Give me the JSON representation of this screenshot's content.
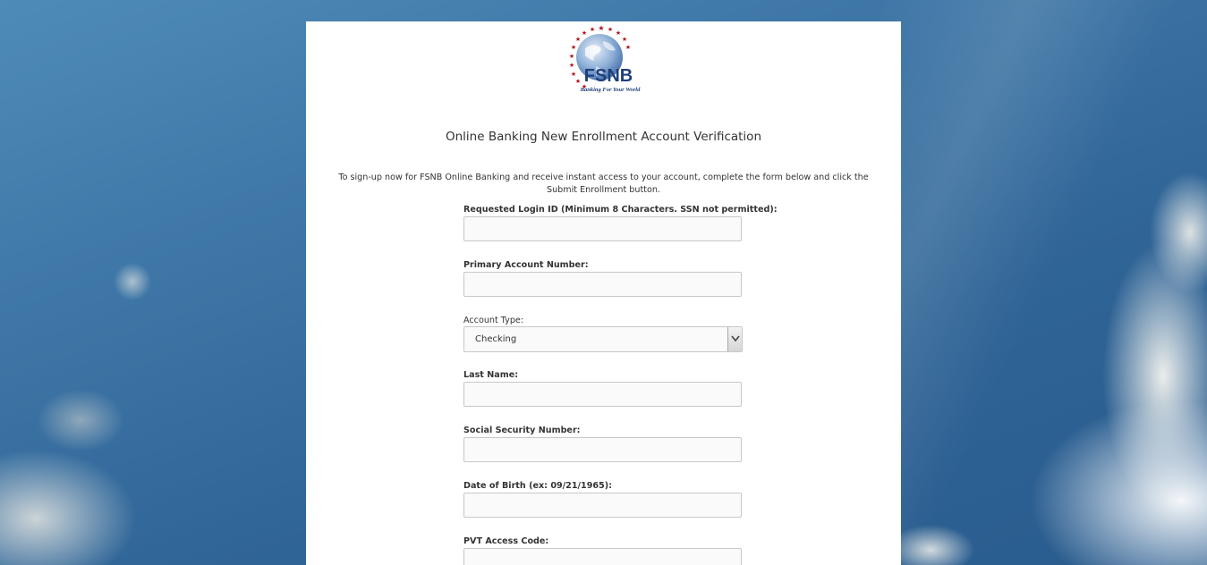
{
  "brand": {
    "logo_text": "FSNB",
    "tagline": "Banking For Your World"
  },
  "page": {
    "title": "Online Banking New Enrollment Account Verification",
    "intro": "To sign-up now for FSNB Online Banking and receive instant access to your account, complete the form below and click the Submit Enrollment button."
  },
  "form": {
    "login_id_label": "Requested Login ID (Minimum 8 Characters. SSN not permitted):",
    "login_id_value": "",
    "account_number_label": "Primary Account Number:",
    "account_number_value": "",
    "account_type_label": "Account Type:",
    "account_type_selected": "Checking",
    "last_name_label": "Last Name:",
    "last_name_value": "",
    "ssn_label": "Social Security Number:",
    "ssn_value": "",
    "dob_label": "Date of Birth (ex: 09/21/1965):",
    "dob_value": "",
    "pvt_label": "PVT Access Code:",
    "pvt_value": ""
  },
  "colors": {
    "logo_blue": "#1f3f7a",
    "star_red": "#b0121b"
  }
}
